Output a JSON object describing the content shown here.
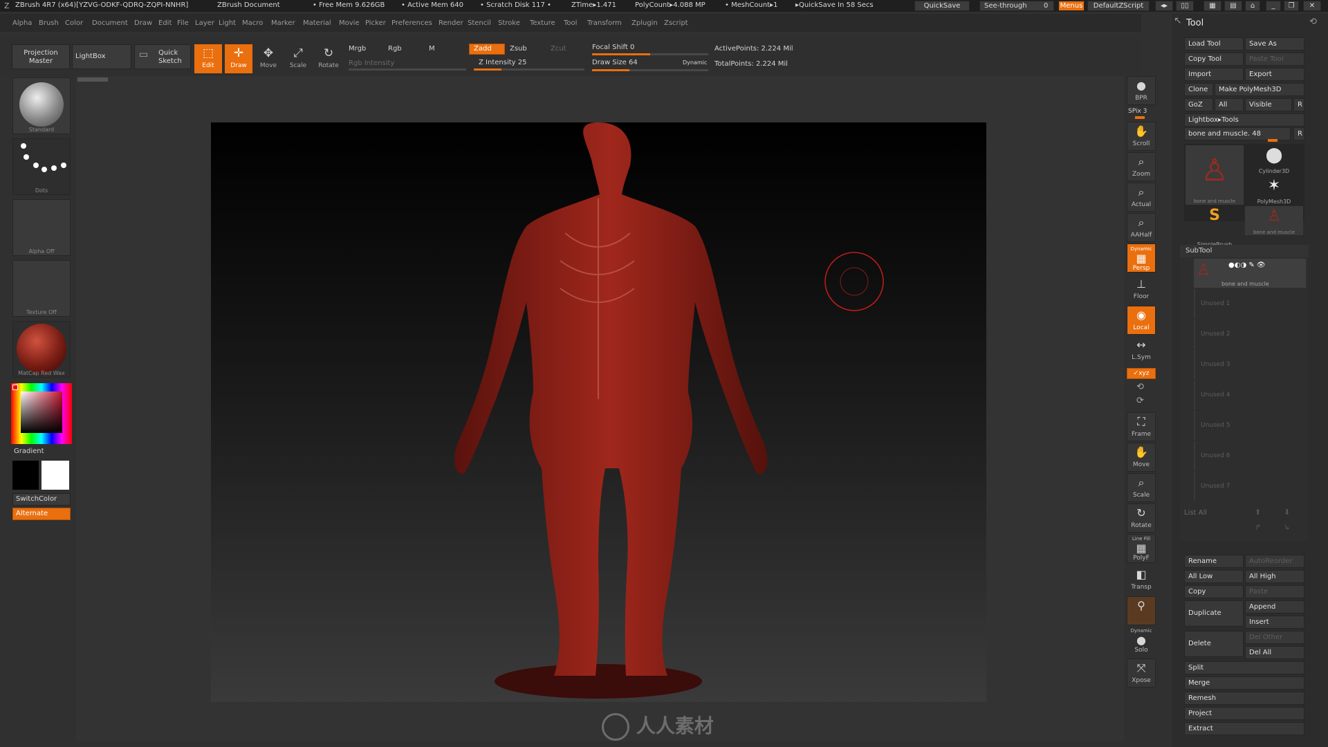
{
  "titlebar": {
    "app": "ZBrush 4R7 (x64)[YZVG-ODKF-QDRQ-ZQPI-NNHR]",
    "document": "ZBrush Document",
    "free_mem": "• Free Mem 9.626GB",
    "active_mem": "• Active Mem 640",
    "scratch": "• Scratch Disk 117 •",
    "ztime": "ZTime▸1.471",
    "polycount": "PolyCount▸4.088 MP",
    "meshcount": "• MeshCount▸1",
    "quicksave_in": "▸QuickSave In 58 Secs",
    "quicksave_btn": "QuickSave",
    "seethrough": "See-through",
    "seethrough_val": "0",
    "menus_btn": "Menus",
    "defaultzscript": "DefaultZScript"
  },
  "menubar": [
    "Alpha",
    "Brush",
    "Color",
    "Document",
    "Draw",
    "Edit",
    "File",
    "Layer",
    "Light",
    "Macro",
    "Marker",
    "Material",
    "Movie",
    "Picker",
    "Preferences",
    "Render",
    "Stencil",
    "Stroke",
    "Texture",
    "Tool",
    "Transform",
    "Zplugin",
    "Zscript"
  ],
  "toolbar": {
    "projection_master": "Projection Master",
    "lightbox": "LightBox",
    "quick_sketch": "Quick Sketch",
    "edit": "Edit",
    "draw": "Draw",
    "move": "Move",
    "scale": "Scale",
    "rotate": "Rotate",
    "mrgb": "Mrgb",
    "rgb": "Rgb",
    "m": "M",
    "rgb_intensity": "Rgb Intensity",
    "zadd": "Zadd",
    "zsub": "Zsub",
    "zcut": "Zcut",
    "z_intensity": "Z Intensity 25",
    "focal_shift": "Focal Shift 0",
    "draw_size": "Draw Size 64",
    "dynamic": "Dynamic",
    "active_points": "ActivePoints: 2.224 Mil",
    "total_points": "TotalPoints: 2.224 Mil",
    "z_intensity_level": 0.25,
    "draw_size_level": 0.32,
    "focal_shift_level": 0.5
  },
  "left_shelf": {
    "brush": "Standard",
    "stroke": "Dots",
    "alpha": "Alpha  Off",
    "texture": "Texture  Off",
    "material": "MatCap  Red  Wax",
    "gradient": "Gradient",
    "switchcolor": "SwitchColor",
    "alternate": "Alternate"
  },
  "right_shelf": {
    "bpr": "BPR",
    "spix": "SPix 3",
    "scroll": "Scroll",
    "zoom": "Zoom",
    "actual": "Actual",
    "aahalf": "AAHalf",
    "dynamic": "Dynamic",
    "persp": "Persp",
    "floor": "Floor",
    "local": "Local",
    "lsym": "L.Sym",
    "xyz": "✓xyz",
    "frame": "Frame",
    "move": "Move",
    "scale": "Scale",
    "rotate": "Rotate",
    "line_fill": "Line Fill",
    "polyf": "PolyF",
    "transp": "Transp",
    "dynamic2": "Dynamic",
    "solo": "Solo",
    "xpose": "Xpose"
  },
  "tool_panel": {
    "title": "Tool",
    "load_tool": "Load Tool",
    "save_as": "Save As",
    "copy_tool": "Copy Tool",
    "paste_tool": "Paste Tool",
    "import": "Import",
    "export": "Export",
    "clone": "Clone",
    "make_polymesh": "Make PolyMesh3D",
    "goz": "GoZ",
    "all": "All",
    "visible": "Visible",
    "r": "R",
    "lightbox_tools": "Lightbox▸Tools",
    "current_tool": "bone and muscle. 48",
    "current_tool_level": 0.85,
    "tools": [
      {
        "name": "bone  and  muscle"
      },
      {
        "name": "Cylinder3D"
      },
      {
        "name": "PolyMesh3D"
      },
      {
        "name": "SimpleBrush"
      },
      {
        "name": "bone  and  muscle"
      }
    ],
    "subtool_title": "SubTool",
    "subtool_active": "bone  and  muscle",
    "unused": [
      "Unused  1",
      "Unused  2",
      "Unused  3",
      "Unused  4",
      "Unused  5",
      "Unused  6",
      "Unused  7"
    ],
    "list_all": "List  All",
    "rename": "Rename",
    "autoreorder": "AutoReorder",
    "all_low": "All  Low",
    "all_high": "All  High",
    "copy": "Copy",
    "paste": "Paste",
    "duplicate": "Duplicate",
    "append": "Append",
    "insert": "Insert",
    "delete": "Delete",
    "del_other": "Del  Other",
    "del_all": "Del  All",
    "split": "Split",
    "merge": "Merge",
    "remesh": "Remesh",
    "project": "Project",
    "extract": "Extract"
  },
  "watermark": "人人素材",
  "colors": {
    "accent": "#ea6f0e",
    "muscle": "#8a1f18",
    "background_dark": "#2b2b2b"
  }
}
